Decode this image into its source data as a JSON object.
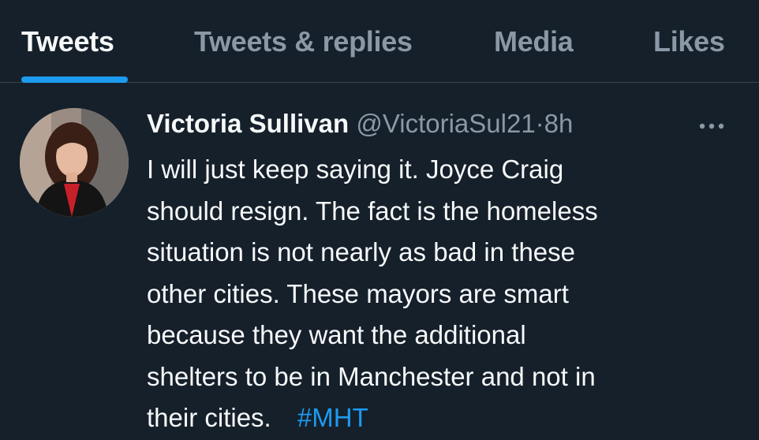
{
  "tabs": [
    {
      "label": "Tweets",
      "active": true
    },
    {
      "label": "Tweets & replies",
      "active": false
    },
    {
      "label": "Media",
      "active": false
    },
    {
      "label": "Likes",
      "active": false
    }
  ],
  "tweet": {
    "display_name": "Victoria Sullivan",
    "handle": "@VictoriaSul21",
    "separator": "·",
    "time": "8h",
    "more_icon": "more-horizontal-icon",
    "text_lines": [
      "I will just keep saying it. Joyce Craig",
      "should resign.  The fact is the homeless",
      "situation is not nearly as bad in these",
      "other cities.  These mayors are smart",
      "because they want the additional",
      "shelters to be in Manchester and not in",
      "their cities. "
    ],
    "hashtag": "#MHT"
  },
  "colors": {
    "background": "#15202b",
    "accent": "#1d9bf0",
    "text_primary": "#f7f9f9",
    "text_secondary": "#8b98a5",
    "divider": "#38444d"
  }
}
